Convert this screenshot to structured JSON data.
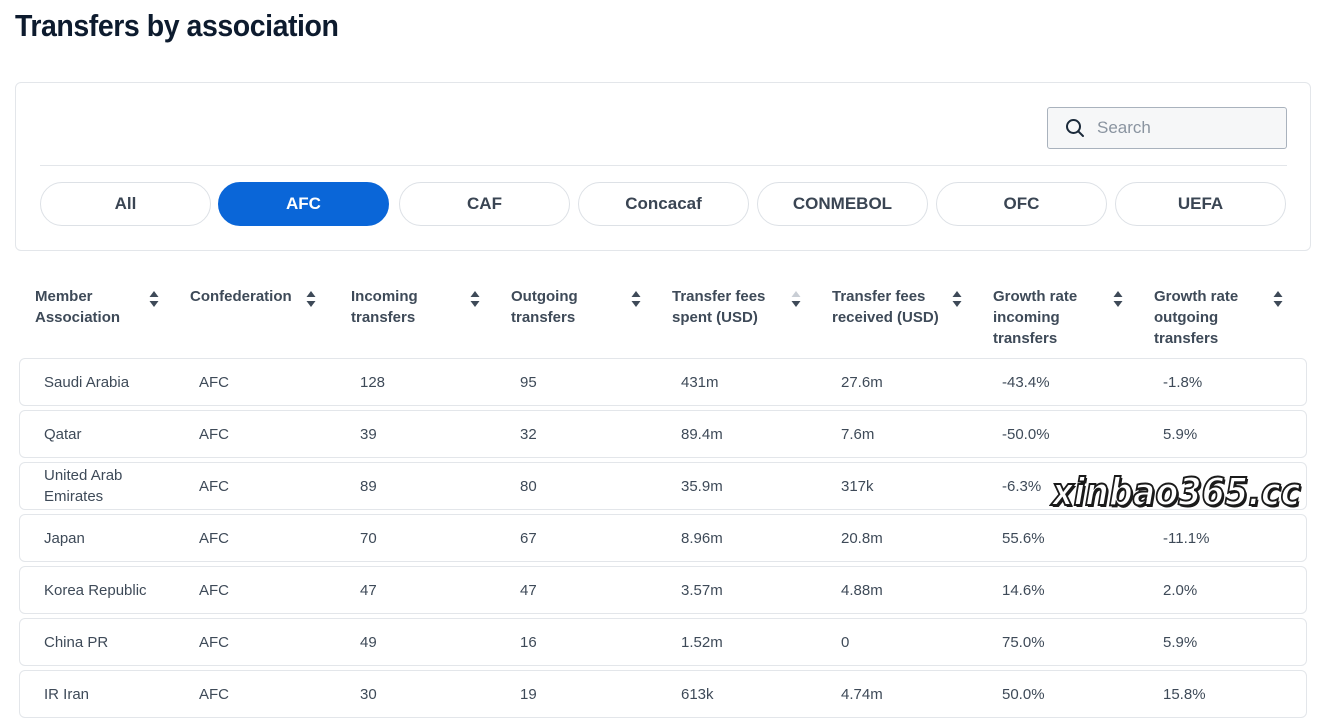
{
  "page": {
    "title": "Transfers by association"
  },
  "search": {
    "placeholder": "Search",
    "value": ""
  },
  "tabs": [
    {
      "label": "All",
      "active": false
    },
    {
      "label": "AFC",
      "active": true
    },
    {
      "label": "CAF",
      "active": false
    },
    {
      "label": "Concacaf",
      "active": false
    },
    {
      "label": "CONMEBOL",
      "active": false
    },
    {
      "label": "OFC",
      "active": false
    },
    {
      "label": "UEFA",
      "active": false
    }
  ],
  "table": {
    "columns": [
      "Member Association",
      "Confederation",
      "Incoming transfers",
      "Outgoing transfers",
      "Transfer fees spent (USD)",
      "Transfer fees received (USD)",
      "Growth rate incoming transfers",
      "Growth rate outgoing transfers"
    ],
    "sorted_column": "Transfer fees spent (USD)",
    "sort_direction": "descending",
    "rows": [
      [
        "Saudi Arabia",
        "AFC",
        "128",
        "95",
        "431m",
        "27.6m",
        "-43.4%",
        "-1.8%"
      ],
      [
        "Qatar",
        "AFC",
        "39",
        "32",
        "89.4m",
        "7.6m",
        "-50.0%",
        "5.9%"
      ],
      [
        "United Arab Emirates",
        "AFC",
        "89",
        "80",
        "35.9m",
        "317k",
        "-6.3%",
        ""
      ],
      [
        "Japan",
        "AFC",
        "70",
        "67",
        "8.96m",
        "20.8m",
        "55.6%",
        "-11.1%"
      ],
      [
        "Korea Republic",
        "AFC",
        "47",
        "47",
        "3.57m",
        "4.88m",
        "14.6%",
        "2.0%"
      ],
      [
        "China PR",
        "AFC",
        "49",
        "16",
        "1.52m",
        "0",
        "75.0%",
        "5.9%"
      ],
      [
        "IR Iran",
        "AFC",
        "30",
        "19",
        "613k",
        "4.74m",
        "50.0%",
        "15.8%"
      ]
    ]
  },
  "watermark": {
    "text": "xinbao365.cc"
  },
  "colors": {
    "accent": "#0a66d8",
    "border": "#e3e6ea",
    "text": "#3e4a58",
    "title": "#0d1b2e"
  }
}
